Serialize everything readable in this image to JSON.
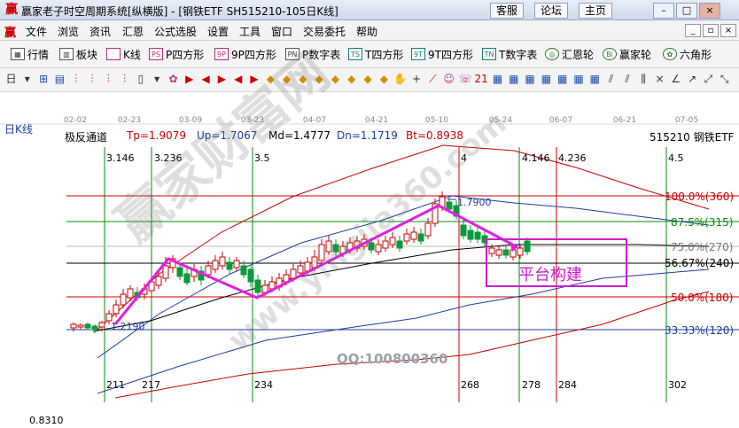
{
  "window": {
    "title": "赢家老子时空周期系统[纵横版] - [钢铁ETF  SH515210-105日K线]",
    "links": [
      "客服",
      "论坛",
      "主页"
    ],
    "controls": [
      "–",
      "□",
      "×"
    ]
  },
  "menu": {
    "items": [
      "文件",
      "浏览",
      "资讯",
      "汇恩",
      "公式选股",
      "设置",
      "工具",
      "窗口",
      "交易委托",
      "帮助"
    ],
    "mdi_controls": [
      "_",
      "▫",
      "×"
    ]
  },
  "toolbar1": [
    {
      "icon": "table-icon",
      "glyph": "▦",
      "label": "行情"
    },
    {
      "icon": "board-icon",
      "glyph": "▥",
      "label": "板块"
    },
    {
      "icon": "kline-icon",
      "glyph": "⫶",
      "label": "K线"
    },
    {
      "icon": "p-square-icon",
      "glyph": "PS",
      "label": "P四方形"
    },
    {
      "icon": "9p-square-icon",
      "glyph": "9P",
      "label": "9P四方形"
    },
    {
      "icon": "p-number-icon",
      "glyph": "PN",
      "label": "P数字表"
    },
    {
      "icon": "t-square-icon",
      "glyph": "TS",
      "label": "T四方形"
    },
    {
      "icon": "9t-square-icon",
      "glyph": "9T",
      "label": "9T四方形"
    },
    {
      "icon": "t-number-icon",
      "glyph": "TN",
      "label": "T数字表"
    },
    {
      "icon": "gann-wheel-icon",
      "glyph": "◎",
      "label": "汇恩轮"
    },
    {
      "icon": "winner-wheel-icon",
      "glyph": "Bi",
      "label": "赢家轮"
    },
    {
      "icon": "hexagon-icon",
      "glyph": "✿",
      "label": "六角形"
    }
  ],
  "toolbar2": [
    "日",
    "▾",
    "⊞",
    "▤",
    "⫶",
    "⫶",
    "⫶",
    "⫶",
    "▯",
    "▾",
    "✿",
    "▶",
    "◀",
    "▶",
    "◀",
    "▶",
    "◆",
    "◆",
    "◆",
    "◆",
    "◆",
    "◆",
    "◆",
    "◆",
    "✋",
    "+",
    "⟋",
    "☺",
    "☏",
    "21",
    "▦",
    "▦",
    "▦",
    "▦",
    "▦",
    "▦",
    "▦",
    "⫽",
    "⫽",
    "⫼",
    "×",
    "∠",
    "↗",
    "⤢",
    "⤡"
  ],
  "chart": {
    "panel_label": "日K线",
    "header": {
      "name": "极反通道",
      "tp": "Tp=1.9079",
      "up": "Up=1.7067",
      "md": "Md=1.4777",
      "dn": "Dn=1.1719",
      "bt": "Bt=0.8938",
      "code": "515210 钢铁ETF"
    },
    "dates": [
      "02-02",
      "02-23",
      "03-09",
      "03-23",
      "04-07",
      "04-21",
      "05-10",
      "05-24",
      "06-07",
      "06-21",
      "07-05"
    ],
    "wave_top": [
      "3.146",
      "3.236",
      "3.5",
      "4",
      "4.146",
      "4.236",
      "4.5"
    ],
    "wave_bottom": [
      "211",
      "217",
      "234",
      "268",
      "278",
      "284",
      "302"
    ],
    "levels": [
      {
        "label": "100.0%(360)",
        "color": "#cc0000"
      },
      {
        "label": "87.5%(315)",
        "color": "#0a8a0a"
      },
      {
        "label": "75.0%(270)",
        "color": "#999999"
      },
      {
        "label": "56.67%(240)",
        "color": "#000000"
      },
      {
        "label": "50.0%(180)",
        "color": "#cc0000"
      },
      {
        "label": "33.33%(120)",
        "color": "#1a3fa0"
      }
    ],
    "price_labels": [
      "1.7900",
      "1.2190"
    ],
    "bottom_value": "0.8310",
    "annotation": "平台构建",
    "qq": "QQ:100800360",
    "watermark": "赢家财富网",
    "watermark2": "www.yingjia360.com"
  }
}
